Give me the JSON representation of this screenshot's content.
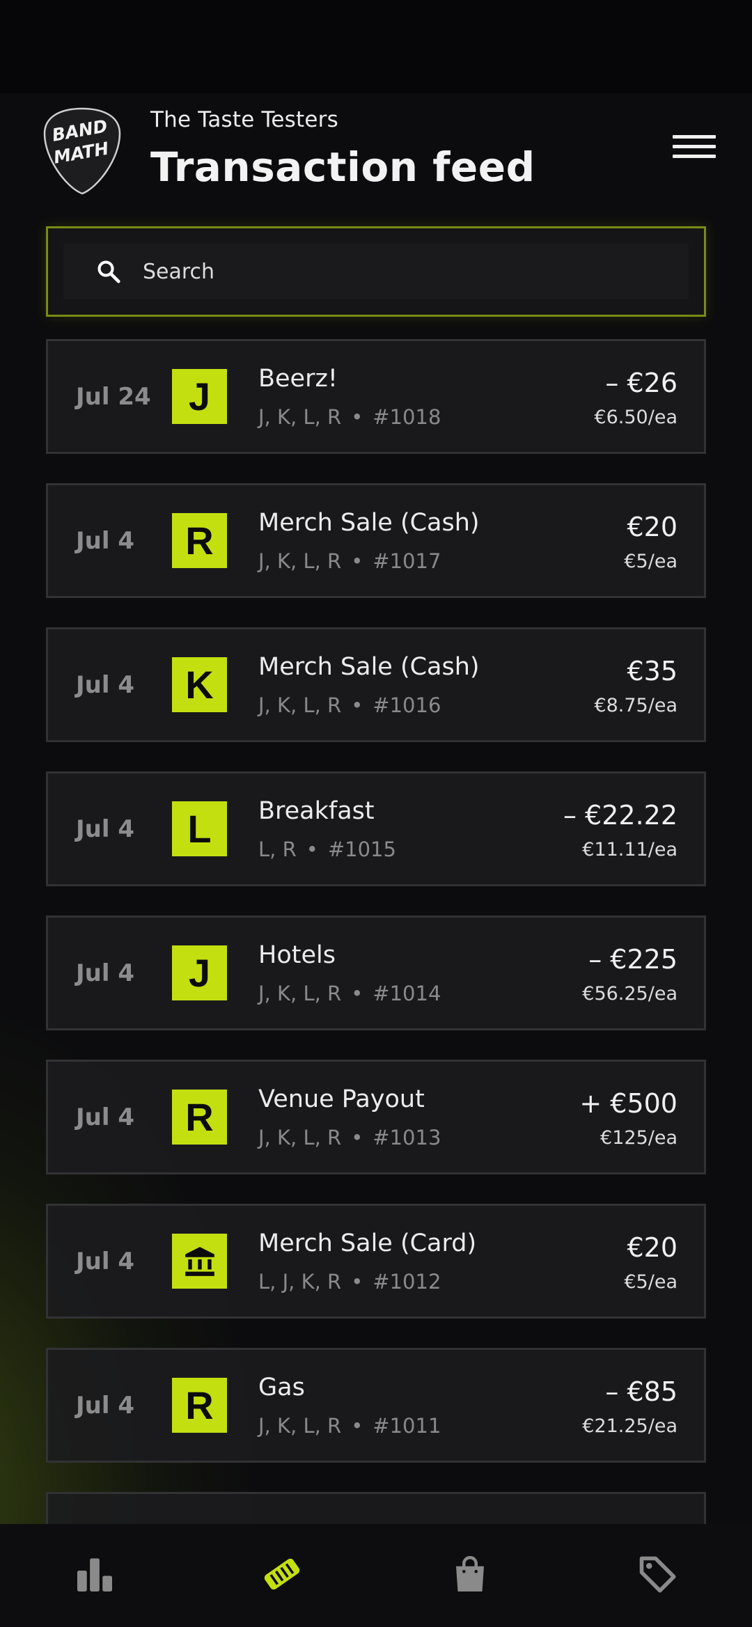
{
  "header": {
    "band_name": "The Taste Testers",
    "title": "Transaction feed",
    "logo_text_line1": "BAND",
    "logo_text_line2": "MATH"
  },
  "search": {
    "placeholder": "Search",
    "value": ""
  },
  "transactions": [
    {
      "date": "Jul 24",
      "avatar": "J",
      "title": "Beerz!",
      "members": "J, K, L, R",
      "number": "#1018",
      "amount": "– €26",
      "each": "€6.50/ea"
    },
    {
      "date": "Jul 4",
      "avatar": "R",
      "title": "Merch Sale (Cash)",
      "members": "J, K, L, R",
      "number": "#1017",
      "amount": "€20",
      "each": "€5/ea"
    },
    {
      "date": "Jul 4",
      "avatar": "K",
      "title": "Merch Sale (Cash)",
      "members": "J, K, L, R",
      "number": "#1016",
      "amount": "€35",
      "each": "€8.75/ea"
    },
    {
      "date": "Jul 4",
      "avatar": "L",
      "title": "Breakfast",
      "members": "L, R",
      "number": "#1015",
      "amount": "– €22.22",
      "each": "€11.11/ea"
    },
    {
      "date": "Jul 4",
      "avatar": "J",
      "title": "Hotels",
      "members": "J, K, L, R",
      "number": "#1014",
      "amount": "– €225",
      "each": "€56.25/ea"
    },
    {
      "date": "Jul 4",
      "avatar": "R",
      "title": "Venue Payout",
      "members": "J, K, L, R",
      "number": "#1013",
      "amount": "+ €500",
      "each": "€125/ea"
    },
    {
      "date": "Jul 4",
      "avatar_icon": "bank-icon",
      "title": "Merch Sale (Card)",
      "members": "L, J, K, R",
      "number": "#1012",
      "amount": "€20",
      "each": "€5/ea"
    },
    {
      "date": "Jul 4",
      "avatar": "R",
      "title": "Gas",
      "members": "J, K, L, R",
      "number": "#1011",
      "amount": "– €85",
      "each": "€21.25/ea"
    }
  ],
  "bottom_nav": [
    {
      "icon": "bar-chart-icon",
      "active": false
    },
    {
      "icon": "handshake-icon",
      "active": true
    },
    {
      "icon": "shopping-bag-icon",
      "active": false
    },
    {
      "icon": "tag-icon",
      "active": false
    }
  ],
  "colors": {
    "accent": "#c4df10",
    "background": "#0c0c0e",
    "card": "#1b1b1d",
    "muted": "#8a8a8a"
  }
}
